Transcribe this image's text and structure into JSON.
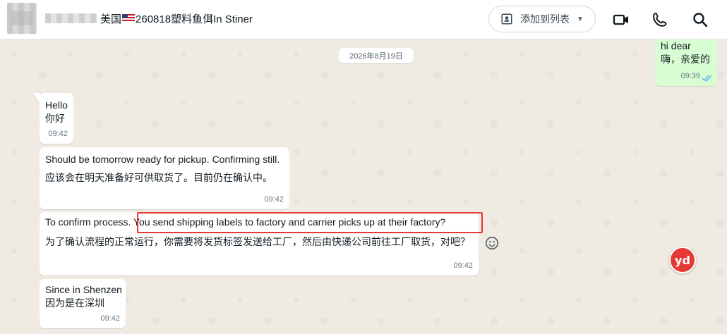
{
  "header": {
    "title_suffix": "美国",
    "title_code": "260818塑料鱼佴In Stiner",
    "add_to_list_label": "添加到列表"
  },
  "chat": {
    "date_divider": "2026年8月19日",
    "messages": [
      {
        "direction": "in",
        "lines": [
          "Hello",
          "你好"
        ],
        "time": "09:42"
      },
      {
        "direction": "in",
        "lines": [
          "Should be tomorrow ready for pickup. Confirming still.",
          "应该会在明天准备好可供取货了。目前仍在确认中。"
        ],
        "time": "09:42"
      },
      {
        "direction": "in",
        "lines": [
          "To confirm process. You send shipping labels to factory and carrier picks up at their factory?",
          "为了确认流程的正常运行，你需要将发货标签发送给工厂，然后由快递公司前往工厂取货，对吧？"
        ],
        "time": "09:42"
      },
      {
        "direction": "in",
        "lines": [
          "Since in Shenzen",
          "因为是在深圳"
        ],
        "time": "09:42"
      },
      {
        "direction": "out",
        "lines": [
          "hi dear",
          "嗨，亲爱的"
        ],
        "time": "09:39"
      }
    ]
  },
  "floating": {
    "yd_badge": "yd"
  },
  "colors": {
    "chat_bg": "#efeae2",
    "incoming_bubble": "#ffffff",
    "outgoing_bubble": "#d9fdd3",
    "highlight_box": "#e53935",
    "read_ticks": "#53bdeb"
  }
}
